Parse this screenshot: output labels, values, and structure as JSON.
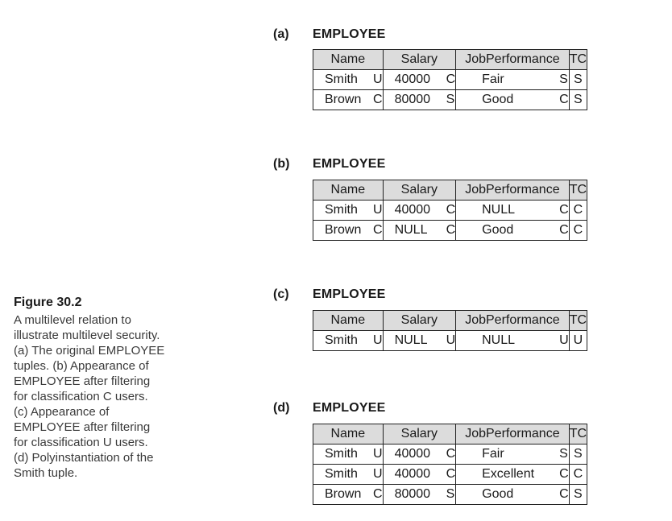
{
  "caption": {
    "title": "Figure 30.2",
    "lines": [
      "A multilevel relation to",
      "illustrate multilevel security.",
      "(a) The original EMPLOYEE",
      "tuples. (b) Appearance of",
      "EMPLOYEE after filtering",
      "for classification C users.",
      "(c) Appearance of",
      "EMPLOYEE after filtering",
      "for classification U users.",
      "(d) Polyinstantiation of the",
      "Smith tuple."
    ]
  },
  "headers": [
    "Name",
    "Salary",
    "JobPerformance",
    "TC"
  ],
  "panels": [
    {
      "letter": "(a)",
      "relation": "EMPLOYEE",
      "rows": [
        {
          "name": "Smith",
          "name_c": "U",
          "salary": "40000",
          "salary_c": "C",
          "job": "Fair",
          "job_c": "S",
          "tc": "S"
        },
        {
          "name": "Brown",
          "name_c": "C",
          "salary": "80000",
          "salary_c": "S",
          "job": "Good",
          "job_c": "C",
          "tc": "S"
        }
      ]
    },
    {
      "letter": "(b)",
      "relation": "EMPLOYEE",
      "rows": [
        {
          "name": "Smith",
          "name_c": "U",
          "salary": "40000",
          "salary_c": "C",
          "job": "NULL",
          "job_c": "C",
          "tc": "C"
        },
        {
          "name": "Brown",
          "name_c": "C",
          "salary": "NULL",
          "salary_c": "C",
          "job": "Good",
          "job_c": "C",
          "tc": "C"
        }
      ]
    },
    {
      "letter": "(c)",
      "relation": "EMPLOYEE",
      "rows": [
        {
          "name": "Smith",
          "name_c": "U",
          "salary": "NULL",
          "salary_c": "U",
          "job": "NULL",
          "job_c": "U",
          "tc": "U"
        }
      ]
    },
    {
      "letter": "(d)",
      "relation": "EMPLOYEE",
      "rows": [
        {
          "name": "Smith",
          "name_c": "U",
          "salary": "40000",
          "salary_c": "C",
          "job": "Fair",
          "job_c": "S",
          "tc": "S"
        },
        {
          "name": "Smith",
          "name_c": "U",
          "salary": "40000",
          "salary_c": "C",
          "job": "Excellent",
          "job_c": "C",
          "tc": "C"
        },
        {
          "name": "Brown",
          "name_c": "C",
          "salary": "80000",
          "salary_c": "S",
          "job": "Good",
          "job_c": "C",
          "tc": "S"
        }
      ]
    }
  ]
}
